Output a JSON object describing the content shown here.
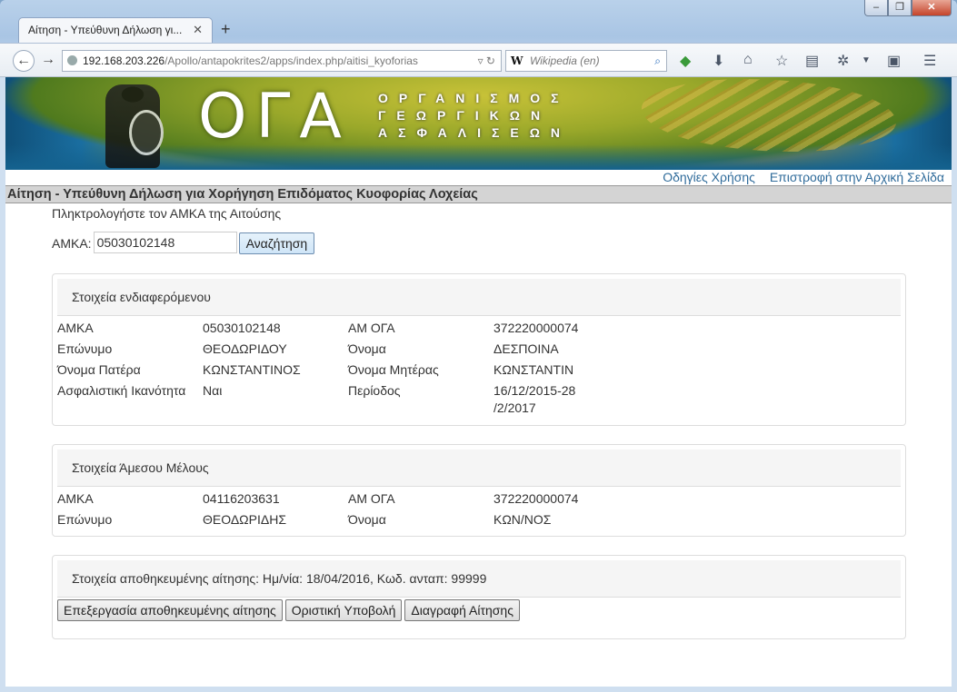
{
  "browser": {
    "tab_title": "Αίτηση - Υπεύθυνη Δήλωση γι...",
    "tab_close": "✕",
    "new_tab": "+",
    "url_host": "192.168.203.226",
    "url_path": "/Apollo/antapokrites2/apps/index.php/aitisi_kyoforias",
    "search_placeholder": "Wikipedia (en)",
    "search_engine_glyph": "W"
  },
  "banner": {
    "logo": "ΟΓΑ",
    "line1": "ΟΡΓΑΝΙΣΜΟΣ",
    "line2": "ΓΕΩΡΓΙΚΩΝ",
    "line3": "ΑΣΦΑΛΙΣΕΩΝ"
  },
  "toplinks": {
    "help": "Οδηγίες Χρήσης",
    "home": "Επιστροφή στην Αρχική Σελίδα"
  },
  "page_title": "Αίτηση - Υπεύθυνη Δήλωση για Χορήγηση Επιδόματος Κυοφορίας Λοχείας",
  "search_form": {
    "prompt": "Πληκτρολογήστε τον ΑΜΚΑ της Αιτούσης",
    "label": "ΑΜΚΑ:",
    "value": "05030102148",
    "button": "Αναζήτηση"
  },
  "insured_panel": {
    "heading": "Στοιχεία ενδιαφερόμενου",
    "rows": [
      {
        "l1": "ΑΜΚΑ",
        "v1": "05030102148",
        "l2": "ΑΜ ΟΓΑ",
        "v2": "372220000074"
      },
      {
        "l1": "Επώνυμο",
        "v1": "ΘΕΟΔΩΡΙΔΟΥ",
        "l2": "Όνομα",
        "v2": "ΔΕΣΠΟΙΝΑ"
      },
      {
        "l1": "Όνομα Πατέρα",
        "v1": "ΚΩΝΣΤΑΝΤΙΝΟΣ",
        "l2": "Όνομα Μητέρας",
        "v2": "ΚΩΝΣΤΑΝΤΙΝ"
      },
      {
        "l1": "Ασφαλιστική Ικανότητα",
        "v1": "Ναι",
        "l2": "Περίοδος",
        "v2": "16/12/2015-28 /2/2017"
      }
    ]
  },
  "member_panel": {
    "heading": "Στοιχεία Άμεσου Μέλους",
    "rows": [
      {
        "l1": "ΑΜΚΑ",
        "v1": "04116203631",
        "l2": "ΑΜ ΟΓΑ",
        "v2": "372220000074"
      },
      {
        "l1": "Επώνυμο",
        "v1": "ΘΕΟΔΩΡΙΔΗΣ",
        "l2": "Όνομα",
        "v2": "ΚΩΝ/ΝΟΣ"
      }
    ]
  },
  "saved_panel": {
    "heading": "Στοιχεία αποθηκευμένης αίτησης: Ημ/νία: 18/04/2016, Κωδ. ανταπ: 99999",
    "buttons": {
      "edit": "Επεξεργασία αποθηκευμένης αίτησης",
      "submit": "Οριστική Υποβολή",
      "delete": "Διαγραφή Αίτησης"
    }
  }
}
